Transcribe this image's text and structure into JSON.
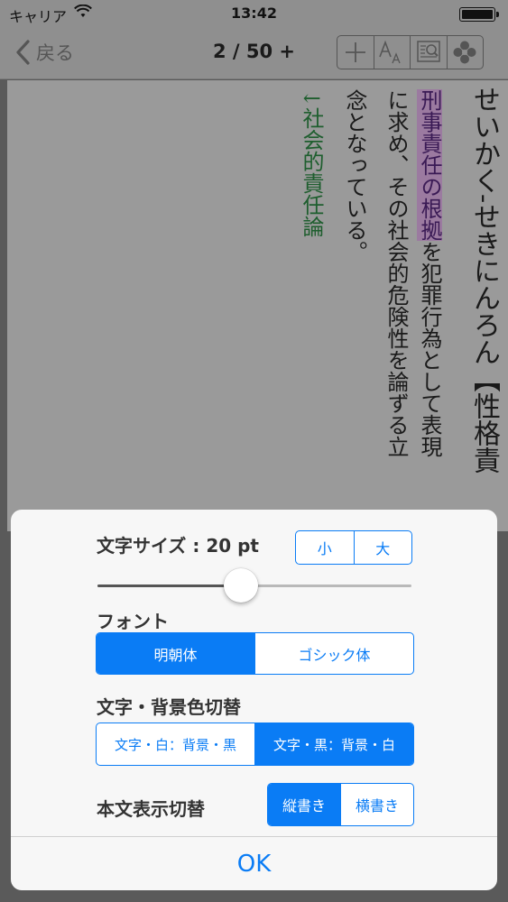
{
  "status_bar": {
    "carrier": "キャリア",
    "time": "13:42"
  },
  "nav": {
    "back_label": "戻る",
    "page_indicator": "2 / 50 +"
  },
  "toolbar": {
    "icons": [
      "plus-icon",
      "font-size-icon",
      "search-document-icon",
      "settings-flower-icon"
    ]
  },
  "content": {
    "columns": [
      {
        "text": "せいかく-せきにんろん【性格責"
      },
      {
        "highlight": "刑事責任の根拠",
        "text": "を犯罪行為として表現"
      },
      {
        "text": "に求め、その社会的危険性を論ずる立"
      },
      {
        "text": "念となっている。"
      },
      {
        "text": "↓社会的責任論"
      }
    ]
  },
  "settings": {
    "font_size_label": "文字サイズ : 20 pt",
    "size_small": "小",
    "size_large": "大",
    "slider_value": 0.41,
    "font_label": "フォント",
    "font_mincho": "明朝体",
    "font_gothic": "ゴシック体",
    "color_label": "文字・背景色切替",
    "color_white_on_black": "文字・白：背景・黒",
    "color_black_on_white": "文字・黒：背景・白",
    "direction_label": "本文表示切替",
    "direction_vertical": "縦書き",
    "direction_horizontal": "横書き",
    "ok_label": "OK"
  },
  "colors": {
    "accent": "#0a7cf5",
    "highlight": "#9b7aa0",
    "link_green": "#1e5e2e"
  }
}
